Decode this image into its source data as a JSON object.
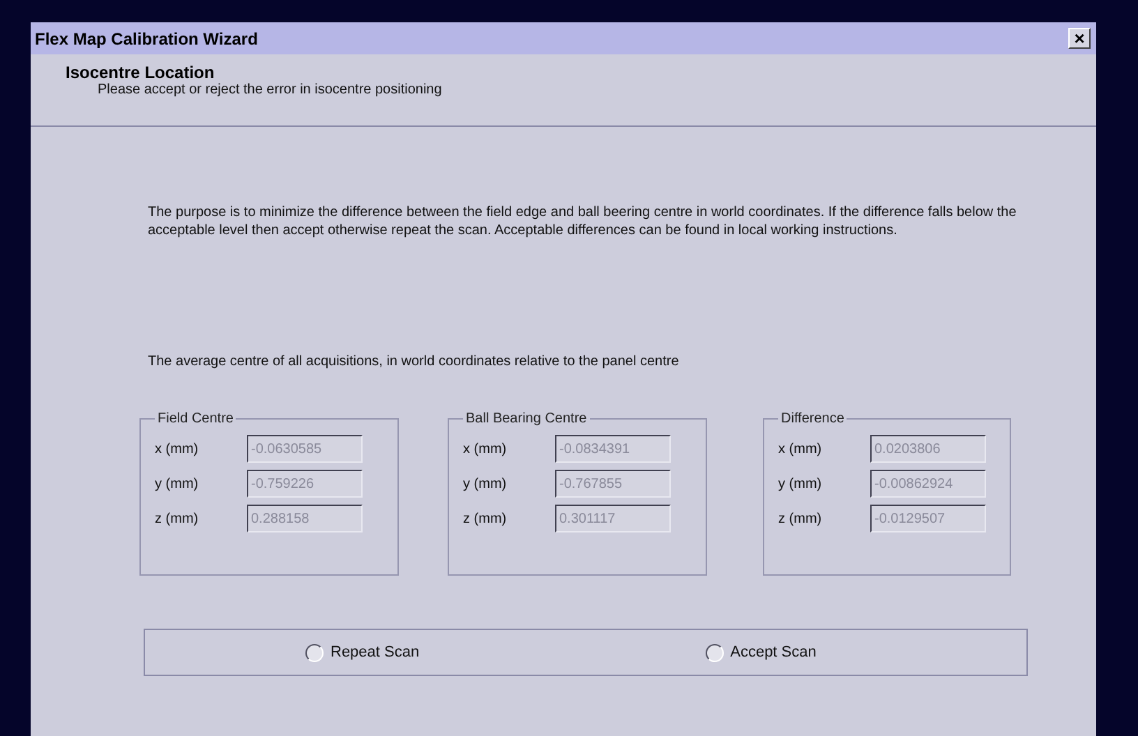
{
  "window": {
    "title": "Flex Map Calibration Wizard",
    "close": "×"
  },
  "header": {
    "title": "Isocentre Location",
    "subtitle": "Please accept or reject the error in isocentre positioning"
  },
  "description": "The purpose is to minimize the difference between the field edge and ball beering centre in world coordinates. If the difference falls below the acceptable level then accept otherwise repeat the scan. Acceptable differences can be found in local working instructions.",
  "caption": "The average centre of all acquisitions, in world coordinates relative to the panel centre",
  "groups": [
    {
      "title": "Field Centre",
      "rows": [
        {
          "label": "x (mm)",
          "value": "-0.0630585"
        },
        {
          "label": "y (mm)",
          "value": "-0.759226"
        },
        {
          "label": "z (mm)",
          "value": "0.288158"
        }
      ]
    },
    {
      "title": "Ball Bearing Centre",
      "rows": [
        {
          "label": "x (mm)",
          "value": "-0.0834391"
        },
        {
          "label": "y (mm)",
          "value": "-0.767855"
        },
        {
          "label": "z (mm)",
          "value": "0.301117"
        }
      ]
    },
    {
      "title": "Difference",
      "rows": [
        {
          "label": "x (mm)",
          "value": "0.0203806"
        },
        {
          "label": "y (mm)",
          "value": "-0.00862924"
        },
        {
          "label": "z (mm)",
          "value": "-0.0129507"
        }
      ]
    }
  ],
  "options": [
    {
      "label": "Repeat Scan",
      "selected": false
    },
    {
      "label": "Accept Scan",
      "selected": false
    }
  ]
}
